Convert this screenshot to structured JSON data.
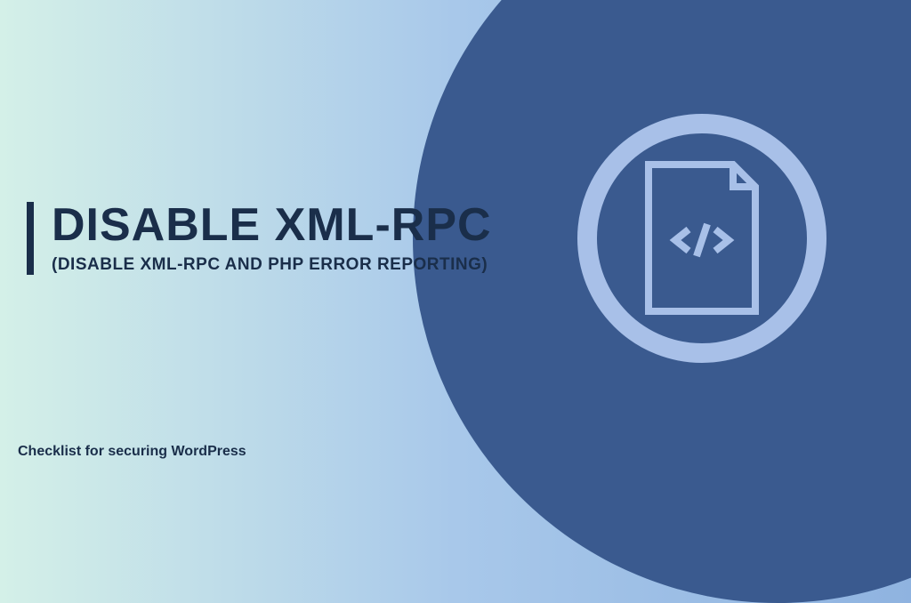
{
  "title": "DISABLE XML-RPC",
  "subtitle": "(DISABLE XML-RPC AND PHP ERROR REPORTING)",
  "footer": "Checklist for securing WordPress",
  "icon": "code-file-icon",
  "colors": {
    "dark_blue": "#3a5a8f",
    "light_blue": "#a8c0e8",
    "text": "#1a2e4a"
  }
}
